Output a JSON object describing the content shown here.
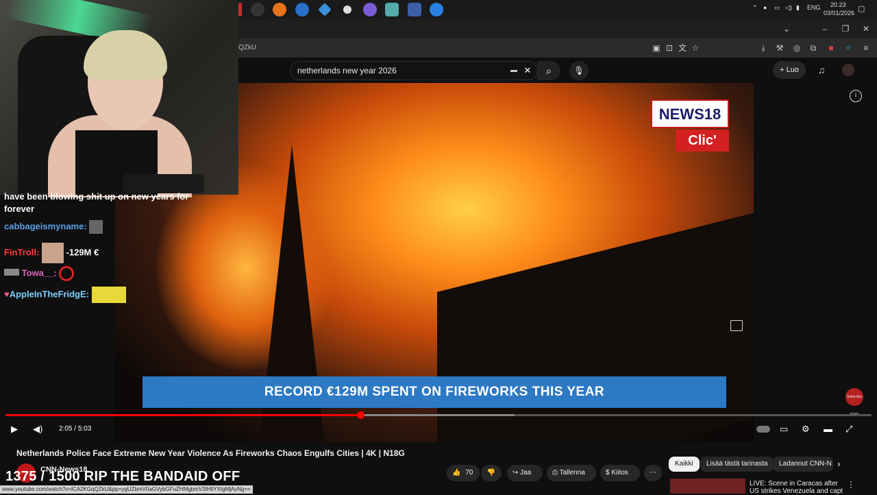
{
  "taskbar": {
    "clock_time": "20.23",
    "clock_date": "03/01/2026",
    "language": "ENG",
    "app_icons": [
      "app-icon",
      "chrome-icon",
      "firefox-icon",
      "ccleaner-icon",
      "diamond-icon",
      "shield-icon",
      "discord-icon",
      "notes-icon",
      "monitor-icon",
      "firefox-active-icon"
    ]
  },
  "browser": {
    "url_fragment": "QZkU",
    "status_url": "www.youtube.com/watch?v=lCA2KGqQZkU&pp=ygUZbmV0aGVybGFuZHMgbmV3IHllYXIgMjAyNg=="
  },
  "youtube": {
    "search_query": "netherlands new year 2026",
    "create_label": "Luo",
    "video": {
      "caption": "RECORD €129M SPENT ON FIREWORKS THIS YEAR",
      "logo_top": "NEWS18",
      "logo_bottom": "Clic'",
      "subscribe_watermark": "Subscribe NOW",
      "time_current": "2:05",
      "time_separator": "/",
      "time_total": "5:03",
      "progress_fraction": 0.41
    },
    "title": "Netherlands Police Face Extreme New Year Violence As Fireworks Chaos Engulfs Cities | 4K | N18G",
    "channel_name": "CNN-News18",
    "likes": "70",
    "actions": {
      "share": "Jaa",
      "save": "Tallenna",
      "thanks": "Kiitos"
    },
    "chips": [
      "Kaikki",
      "Lisää tästä tarinasta",
      "Ladannut CNN-N"
    ],
    "recommendation_title": "LIVE: Scene in Caracas after US strikes Venezuela and capt",
    "accent_color": "#ff0000"
  },
  "stream_overlay": {
    "chat": [
      {
        "user": "",
        "message": "have been blowing shit up on new years for forever"
      },
      {
        "user": "cabbageismyname:",
        "message": ""
      },
      {
        "user": "FinTroll:",
        "message": "-129M €"
      },
      {
        "user": "Towa__:",
        "message": ""
      },
      {
        "user": "AppleInTheFridgE:",
        "message": ""
      }
    ],
    "counter": "1375 / 1500 RIP THE BANDAID OFF"
  }
}
